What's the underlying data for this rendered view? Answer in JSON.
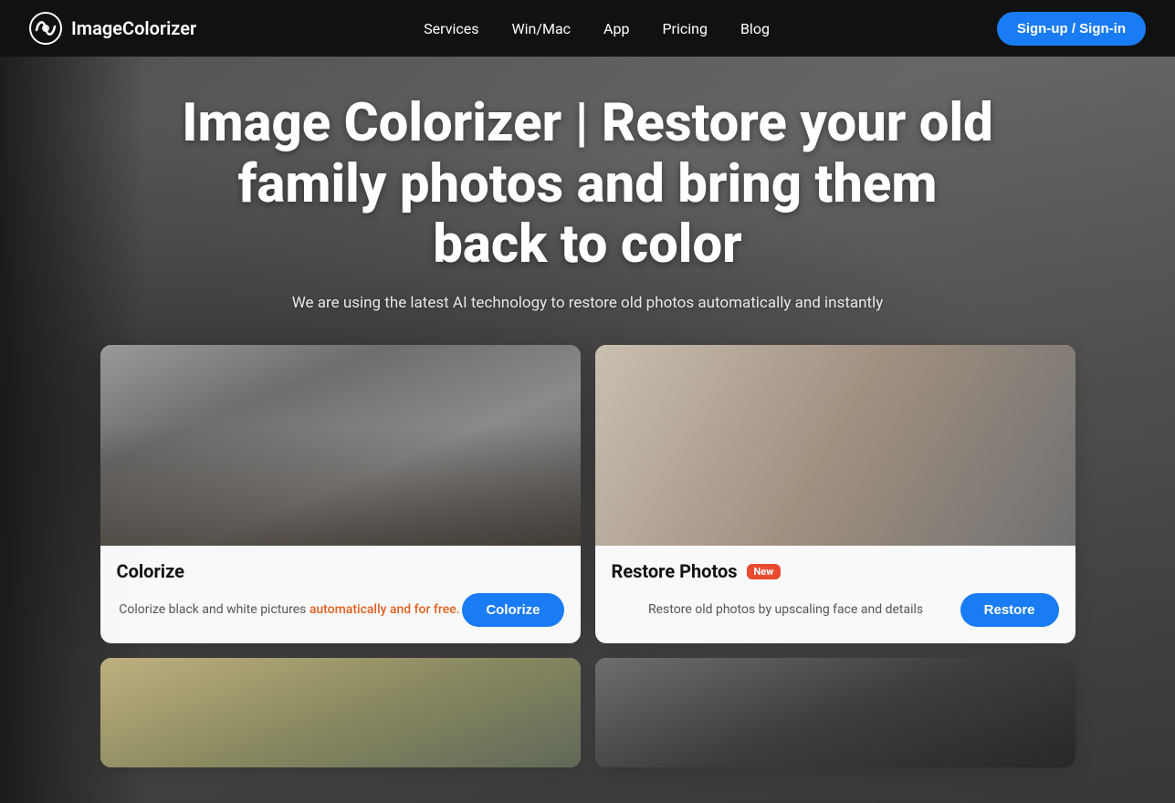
{
  "navbar": {
    "brand_name": "ImageColorizer",
    "links": [
      {
        "id": "services",
        "label": "Services"
      },
      {
        "id": "winmac",
        "label": "Win/Mac"
      },
      {
        "id": "app",
        "label": "App"
      },
      {
        "id": "pricing",
        "label": "Pricing"
      },
      {
        "id": "blog",
        "label": "Blog"
      }
    ],
    "signup_label": "Sign-up / Sign-in"
  },
  "hero": {
    "title": "Image Colorizer | Restore your old family photos and bring them back to color",
    "subtitle": "We are using the latest AI technology to restore old photos automatically and instantly"
  },
  "cards": [
    {
      "id": "colorize",
      "title": "Colorize",
      "desc_plain": "Colorize black and white pictures automatically and for free.",
      "desc_highlight": "automatically and for free.",
      "button_label": "Colorize",
      "new": false
    },
    {
      "id": "restore",
      "title": "Restore Photos",
      "desc": "Restore old photos by upscaling face and details",
      "button_label": "Restore",
      "new": true,
      "new_badge_label": "New"
    }
  ]
}
